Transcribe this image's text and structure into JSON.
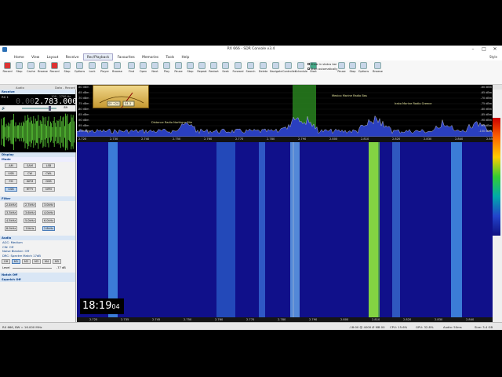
{
  "window": {
    "title": "RX 666 - SDR Console v3.4"
  },
  "menu": [
    "Home",
    "View",
    "Layout",
    "Receive",
    "Rec/Playback",
    "Favourites",
    "Memories",
    "Tools",
    "Help"
  ],
  "menu_right": "Style",
  "ribbon": {
    "buttons": [
      {
        "label": "Record",
        "icon": "record-icon"
      },
      {
        "label": "Stop",
        "icon": "stop-icon"
      },
      {
        "label": "Cache",
        "icon": "cache-icon"
      },
      {
        "label": "Browse",
        "icon": "folder-icon"
      },
      {
        "label": "Record",
        "icon": "record-icon"
      },
      {
        "label": "Stop",
        "icon": "stop-icon"
      },
      {
        "label": "Options",
        "icon": "options-icon"
      },
      {
        "label": "Lock",
        "icon": "lock-icon"
      },
      {
        "label": "Player",
        "icon": "player-icon"
      },
      {
        "label": "Browse",
        "icon": "folder-icon"
      },
      {
        "label": "Find",
        "icon": "find-icon"
      },
      {
        "label": "Open",
        "icon": "open-icon"
      },
      {
        "label": "Next",
        "icon": "next-icon"
      },
      {
        "label": "Play",
        "icon": "play-icon"
      },
      {
        "label": "Pause",
        "icon": "pause-icon"
      },
      {
        "label": "Stop",
        "icon": "stop-icon"
      },
      {
        "label": "Repeat",
        "icon": "repeat-icon"
      },
      {
        "label": "Restart",
        "icon": "restart-icon"
      },
      {
        "label": "Seek",
        "icon": "seek-icon"
      },
      {
        "label": "Forward",
        "icon": "forward-icon"
      },
      {
        "label": "Search",
        "icon": "search-icon"
      },
      {
        "label": "Delete",
        "icon": "delete-icon"
      },
      {
        "label": "Navigate",
        "icon": "navigate-icon"
      },
      {
        "label": "Controller",
        "icon": "controller-icon"
      },
      {
        "label": "Schedule",
        "icon": "schedule-icon"
      },
      {
        "label": "Start",
        "icon": "start-icon"
      },
      {
        "label": "Pause",
        "icon": "pause-icon"
      },
      {
        "label": "Stop",
        "icon": "stop-icon"
      },
      {
        "label": "Options",
        "icon": "options-icon"
      },
      {
        "label": "Browse",
        "icon": "folder-icon"
      }
    ],
    "checkboxes": [
      "Show in status bar",
      "Start automatically"
    ],
    "groups": [
      "Audio",
      "Data - Record",
      "Data - Playback",
      "Data - Scheduler",
      "Video"
    ]
  },
  "left": {
    "receive_header": "Receive",
    "rx_label": "RX 1",
    "frequency_dim": "0.00",
    "frequency": "2.783.000",
    "range": "100 - 2700 Hz",
    "volume_value": "89",
    "display_header": "Display",
    "mode_header": "Mode",
    "modes": [
      "AM",
      "SAM",
      "LSB",
      "USB",
      "CW",
      "CWL",
      "FM",
      "WFM",
      "DSB",
      "USB",
      "RTTY",
      "NFM"
    ],
    "selected_mode_index": 9,
    "filter_header": "Filter",
    "filters": [
      "2.4kHz",
      "2.7kHz",
      "3.0kHz",
      "3.3kHz",
      "3.6kHz",
      "4.0kHz",
      "4.5kHz",
      "5.0kHz",
      "6.0kHz",
      "8.0kHz",
      "10kHz",
      "2.8kHz"
    ],
    "selected_filter_index": 11,
    "audio_header": "Audio",
    "audio_items": [
      "AGC: Medium",
      "CW: Off",
      "Noise Blanker: Off",
      "DRC: Spectre Match 17dB"
    ],
    "memory_buttons": [
      "M1",
      "M2",
      "M3",
      "M4",
      "M5"
    ],
    "level_label": "Level",
    "level_value": "-77 dB",
    "notch_header": "Notch Off",
    "squelch_header": "Squelch Off"
  },
  "spectrum": {
    "db_labels": [
      "-60 dBm",
      "-65 dBm",
      "-70 dBm",
      "-75 dBm",
      "-80 dBm",
      "-85 dBm",
      "-90 dBm",
      "-95 dBm",
      "-100 dBm"
    ],
    "station_labels": [
      "Distance Radio Northern Site",
      "Mexico Marine Radio Bas",
      "Irako Marine Radio Greece"
    ],
    "meter_values": [
      "S9 +24",
      "S4.3"
    ]
  },
  "axis": {
    "top_ticks": [
      "2.720",
      "2.730",
      "2.740",
      "2.750",
      "2.760",
      "2.770",
      "2.780",
      "2.790",
      "2.800",
      "2.810",
      "2.820",
      "2.830",
      "2.840",
      "2.850"
    ],
    "bottom_ticks": [
      "2.725",
      "2.735",
      "2.745",
      "2.750",
      "2.760",
      "2.770",
      "2.780",
      "2.790",
      "2.800",
      "2.810",
      "2.820",
      "2.830",
      "2.840"
    ]
  },
  "clock": {
    "hm": "18:19",
    "sec": "04"
  },
  "status": {
    "left": "RX 666, BW = 16.000 MHz",
    "middle": "-18:00 @ 4000 Ø MB 00",
    "cpu": "CPU: 15.6%",
    "gpu": "GPU: 32.8%",
    "audio": "Audio: 50ms",
    "size": "Size: 3.4 GB"
  }
}
